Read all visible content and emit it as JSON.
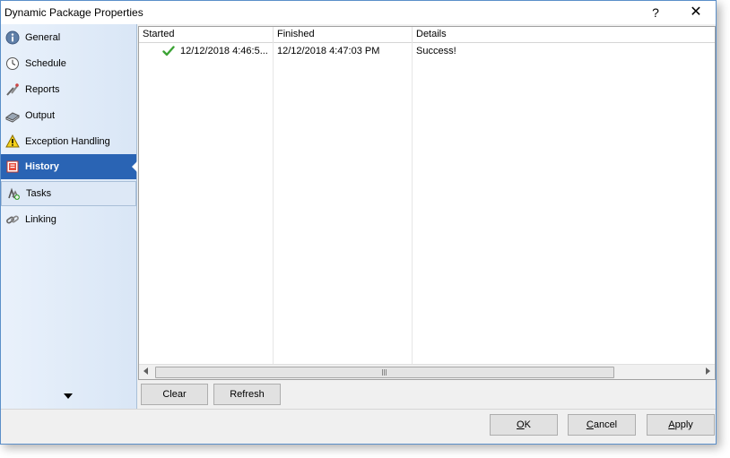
{
  "window": {
    "title": "Dynamic Package Properties",
    "help_label": "?",
    "close_label": "✕"
  },
  "sidebar": {
    "items": [
      {
        "label": "General",
        "icon": "info-icon"
      },
      {
        "label": "Schedule",
        "icon": "clock-icon"
      },
      {
        "label": "Reports",
        "icon": "reports-icon"
      },
      {
        "label": "Output",
        "icon": "output-icon"
      },
      {
        "label": "Exception Handling",
        "icon": "warning-icon"
      },
      {
        "label": "History",
        "icon": "history-icon"
      },
      {
        "label": "Tasks",
        "icon": "tasks-icon"
      },
      {
        "label": "Linking",
        "icon": "link-icon"
      }
    ],
    "active": "History",
    "highlighted": "Tasks"
  },
  "history_table": {
    "columns": [
      "Started",
      "Finished",
      "Details"
    ],
    "rows": [
      {
        "started": "12/12/2018 4:46:5...",
        "finished": "12/12/2018 4:47:03 PM",
        "details": "Success!",
        "status": "success"
      }
    ]
  },
  "actions": {
    "clear_label": "Clear",
    "refresh_label": "Refresh"
  },
  "footer": {
    "ok_label": "OK",
    "ok_mnemonic": "O",
    "ok_rest": "K",
    "cancel_label": "Cancel",
    "cancel_mnemonic": "C",
    "cancel_rest": "ancel",
    "apply_label": "Apply",
    "apply_mnemonic": "A",
    "apply_rest": "pply"
  },
  "colors": {
    "accent": "#2a64b4",
    "success": "#3ca335",
    "sidebar_bg": "#e3edf9"
  }
}
